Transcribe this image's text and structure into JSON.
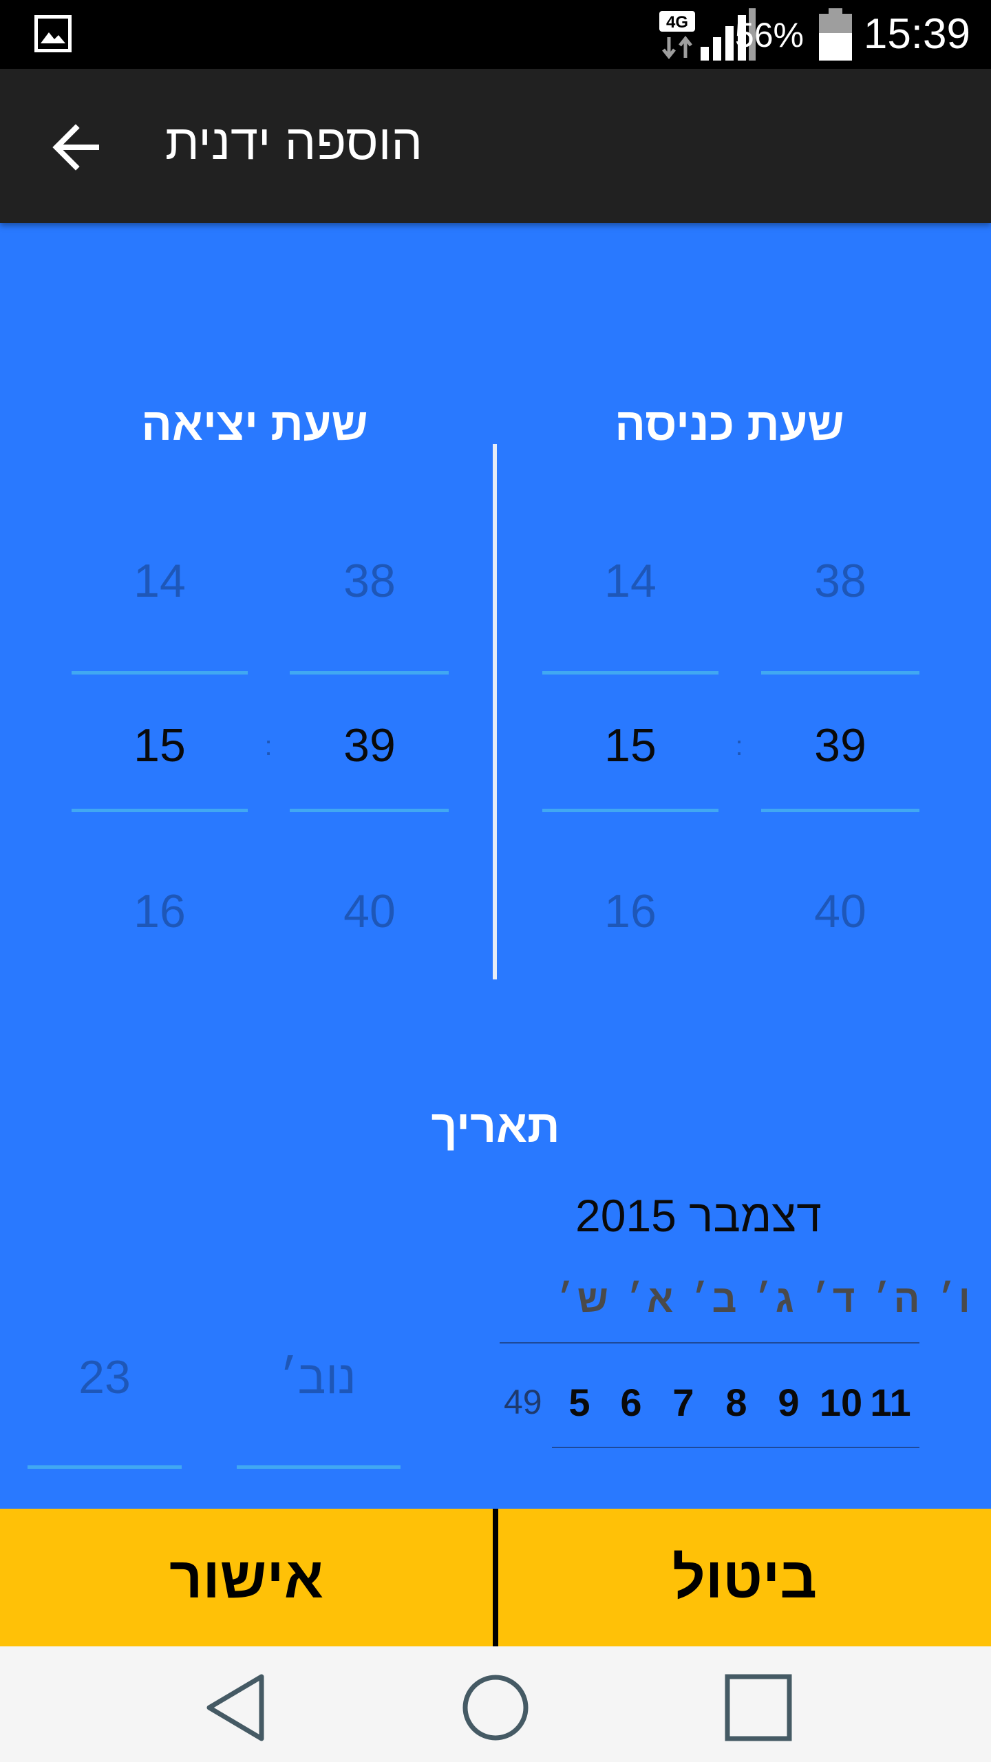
{
  "status_bar": {
    "network": "4G",
    "battery": "56%",
    "time": "15:39"
  },
  "app_bar": {
    "title": "הוספה ידנית"
  },
  "entry_time": {
    "title": "שעת כניסה",
    "hour": {
      "prev": "14",
      "selected": "15",
      "next": "16"
    },
    "minute": {
      "prev": "38",
      "selected": "39",
      "next": "40"
    },
    "separator": ":"
  },
  "exit_time": {
    "title": "שעת יציאה",
    "hour": {
      "prev": "14",
      "selected": "15",
      "next": "16"
    },
    "minute": {
      "prev": "38",
      "selected": "39",
      "next": "40"
    },
    "separator": ":"
  },
  "date": {
    "title": "תאריך",
    "calendar": {
      "month_label": "דצמבר 2015",
      "weekdays": "ו׳ ה׳ ד׳ ג׳ ב׳ א׳ ש׳",
      "week_number": "49",
      "days": [
        "5",
        "6",
        "7",
        "8",
        "9",
        "10",
        "11"
      ]
    },
    "spinner": {
      "month": "נוב׳",
      "day": "23"
    }
  },
  "actions": {
    "confirm": "אישור",
    "cancel": "ביטול"
  },
  "colors": {
    "background": "#2979FF",
    "app_bar": "#212121",
    "buttons": "#FFC107",
    "accent_line": "#41A8F2"
  }
}
